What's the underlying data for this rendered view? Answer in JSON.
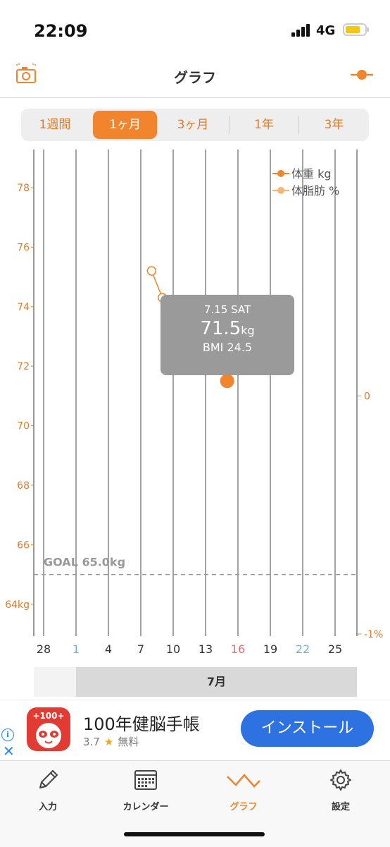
{
  "status_bar": {
    "time": "22:09",
    "network": "4G"
  },
  "nav": {
    "title": "グラフ"
  },
  "segments": [
    {
      "label": "1週間",
      "active": false
    },
    {
      "label": "1ヶ月",
      "active": true
    },
    {
      "label": "3ヶ月",
      "active": false
    },
    {
      "label": "1年",
      "active": false
    },
    {
      "label": "3年",
      "active": false
    }
  ],
  "chart_data": {
    "type": "line",
    "series": [
      {
        "name": "体重 kg",
        "color": "#f0852d",
        "points": [
          {
            "x": 15,
            "y": 71.5
          }
        ]
      },
      {
        "name": "体脂肪 %",
        "color": "#f3b57a",
        "points": [
          {
            "x": 8,
            "y": 75.2
          },
          {
            "x": 9,
            "y": 74.3
          }
        ]
      }
    ],
    "y_left_ticks": [
      "78",
      "76",
      "74",
      "72",
      "70",
      "68",
      "66",
      "64kg"
    ],
    "y_left_values": [
      78,
      76,
      74,
      72,
      70,
      68,
      66,
      64
    ],
    "y_right_ticks": [
      {
        "label": "0",
        "value": 71.0
      },
      {
        "label": "-1%",
        "value": 63.0
      }
    ],
    "x_ticks": [
      {
        "label": "28",
        "color": "#333333"
      },
      {
        "label": "1",
        "color": "#6fb3d6"
      },
      {
        "label": "4",
        "color": "#333333"
      },
      {
        "label": "7",
        "color": "#333333"
      },
      {
        "label": "10",
        "color": "#333333"
      },
      {
        "label": "13",
        "color": "#333333"
      },
      {
        "label": "16",
        "color": "#e0707a"
      },
      {
        "label": "19",
        "color": "#333333"
      },
      {
        "label": "22",
        "color": "#6fb3d6"
      },
      {
        "label": "25",
        "color": "#333333"
      }
    ],
    "goal": {
      "label": "GOAL 65.0kg",
      "value": 65.0
    },
    "ylim": [
      63,
      79
    ]
  },
  "tooltip": {
    "date": "7.15 SAT",
    "weight": "71.5",
    "unit": "kg",
    "bmi": "BMI 24.5"
  },
  "month_label": "7月",
  "ad": {
    "app_name": "100年健脳手帳",
    "rating": "3.7",
    "price": "無料",
    "install": "インストール",
    "logo_text": "+100+"
  },
  "tabs": [
    {
      "label": "入力",
      "icon": "pencil-icon",
      "active": false
    },
    {
      "label": "カレンダー",
      "icon": "calendar-icon",
      "active": false
    },
    {
      "label": "グラフ",
      "icon": "graph-icon",
      "active": true
    },
    {
      "label": "設定",
      "icon": "gear-icon",
      "active": false
    }
  ]
}
